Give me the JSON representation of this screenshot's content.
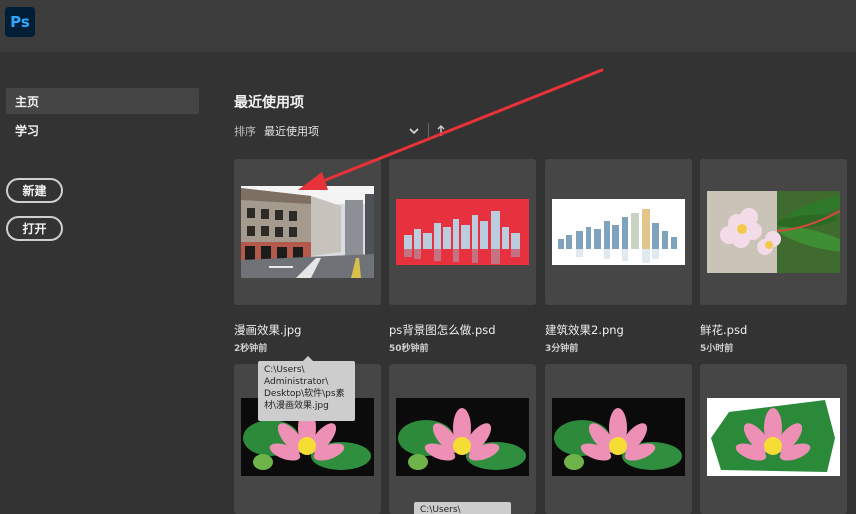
{
  "app": {
    "logo_text": "Ps"
  },
  "sidebar": {
    "nav": [
      {
        "label": "主页"
      },
      {
        "label": "学习"
      }
    ],
    "buttons": {
      "new_label": "新建",
      "open_label": "打开"
    }
  },
  "main": {
    "section_title": "最近使用项",
    "sort": {
      "label": "排序",
      "value": "最近使用项"
    },
    "files": [
      {
        "name": "漫画效果.jpg",
        "time": "2秒钟前"
      },
      {
        "name": "ps背景图怎么做.psd",
        "time": "50秒钟前"
      },
      {
        "name": "建筑效果2.png",
        "time": "3分钟前"
      },
      {
        "name": "鲜花.psd",
        "time": "5小时前"
      }
    ]
  },
  "tooltip": {
    "lines": [
      "C:\\Users\\",
      "Administrator\\",
      "Desktop\\软件\\ps素",
      "材\\漫画效果.jpg"
    ],
    "partial_text": "C:\\Users\\"
  },
  "colors": {
    "annotation_arrow": "#e8323a",
    "background": "#333333",
    "card": "#464646"
  }
}
